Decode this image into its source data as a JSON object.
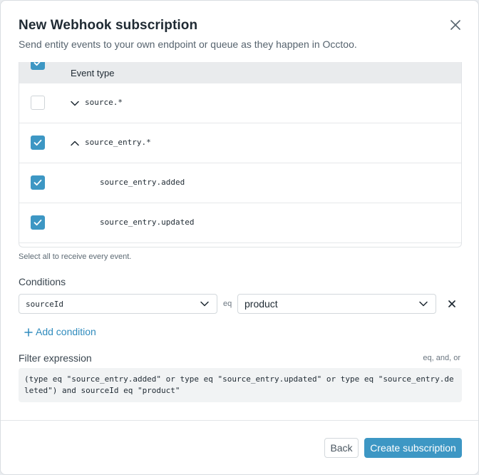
{
  "dialog": {
    "title": "New Webhook subscription",
    "subtitle": "Send entity events to your own endpoint or queue as they happen in Occtoo."
  },
  "events_table": {
    "header_label": "Event type",
    "header_checked": true,
    "rows": [
      {
        "label": "source.*",
        "checked": false,
        "expanded": false,
        "indent": 0
      },
      {
        "label": "source_entry.*",
        "checked": true,
        "expanded": true,
        "indent": 0
      },
      {
        "label": "source_entry.added",
        "checked": true,
        "indent": 1
      },
      {
        "label": "source_entry.updated",
        "checked": true,
        "indent": 1
      }
    ],
    "hint": "Select all to receive every event."
  },
  "conditions": {
    "label": "Conditions",
    "field_value": "sourceId",
    "operator": "eq",
    "value_value": "product",
    "add_label": "Add condition"
  },
  "filter": {
    "label": "Filter expression",
    "hint": "eq, and, or",
    "expression": "(type eq \"source_entry.added\" or type eq \"source_entry.updated\" or type eq \"source_entry.deleted\") and sourceId eq \"product\""
  },
  "footer": {
    "back_label": "Back",
    "create_label": "Create subscription"
  },
  "colors": {
    "accent": "#3d97c4",
    "link": "#2f8bbd"
  }
}
